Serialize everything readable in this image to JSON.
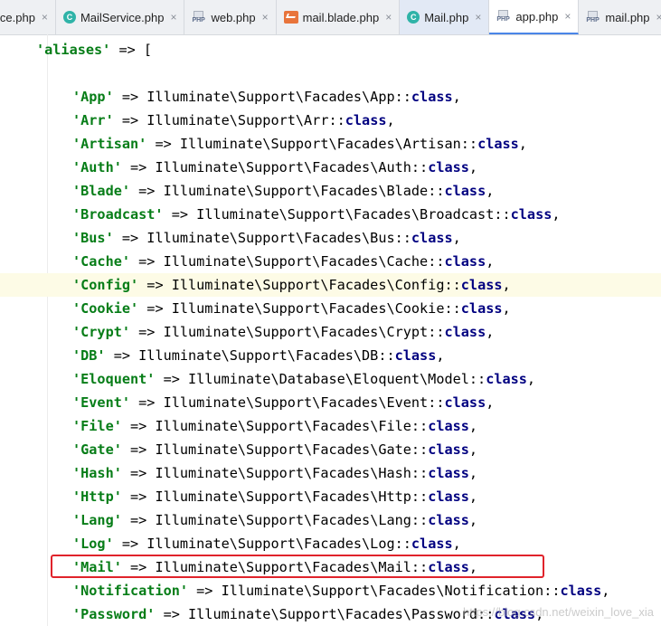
{
  "tabs": [
    {
      "label": "ice.php",
      "icon": "php-file-icon",
      "active": false
    },
    {
      "label": "MailService.php",
      "icon": "php-class-icon",
      "active": false
    },
    {
      "label": "web.php",
      "icon": "php-file-icon",
      "active": false
    },
    {
      "label": "mail.blade.php",
      "icon": "blade-file-icon",
      "active": false
    },
    {
      "label": "Mail.php",
      "icon": "php-class-icon",
      "active": false,
      "highlight": true
    },
    {
      "label": "app.php",
      "icon": "php-file-icon",
      "active": true
    },
    {
      "label": "mail.php",
      "icon": "php-file-icon",
      "active": false
    }
  ],
  "code": {
    "opening": {
      "key": "'aliases'",
      "arrow": " => ",
      "bracket": "["
    },
    "aliases": [
      {
        "key": "'App'",
        "value": "Illuminate\\Support\\Facades\\App"
      },
      {
        "key": "'Arr'",
        "value": "Illuminate\\Support\\Arr"
      },
      {
        "key": "'Artisan'",
        "value": "Illuminate\\Support\\Facades\\Artisan"
      },
      {
        "key": "'Auth'",
        "value": "Illuminate\\Support\\Facades\\Auth"
      },
      {
        "key": "'Blade'",
        "value": "Illuminate\\Support\\Facades\\Blade"
      },
      {
        "key": "'Broadcast'",
        "value": "Illuminate\\Support\\Facades\\Broadcast"
      },
      {
        "key": "'Bus'",
        "value": "Illuminate\\Support\\Facades\\Bus"
      },
      {
        "key": "'Cache'",
        "value": "Illuminate\\Support\\Facades\\Cache"
      },
      {
        "key": "'Config'",
        "value": "Illuminate\\Support\\Facades\\Config",
        "highlighted": true
      },
      {
        "key": "'Cookie'",
        "value": "Illuminate\\Support\\Facades\\Cookie"
      },
      {
        "key": "'Crypt'",
        "value": "Illuminate\\Support\\Facades\\Crypt"
      },
      {
        "key": "'DB'",
        "value": "Illuminate\\Support\\Facades\\DB"
      },
      {
        "key": "'Eloquent'",
        "value": "Illuminate\\Database\\Eloquent\\Model"
      },
      {
        "key": "'Event'",
        "value": "Illuminate\\Support\\Facades\\Event"
      },
      {
        "key": "'File'",
        "value": "Illuminate\\Support\\Facades\\File"
      },
      {
        "key": "'Gate'",
        "value": "Illuminate\\Support\\Facades\\Gate"
      },
      {
        "key": "'Hash'",
        "value": "Illuminate\\Support\\Facades\\Hash"
      },
      {
        "key": "'Http'",
        "value": "Illuminate\\Support\\Facades\\Http"
      },
      {
        "key": "'Lang'",
        "value": "Illuminate\\Support\\Facades\\Lang"
      },
      {
        "key": "'Log'",
        "value": "Illuminate\\Support\\Facades\\Log"
      },
      {
        "key": "'Mail'",
        "value": "Illuminate\\Support\\Facades\\Mail",
        "boxed": true
      },
      {
        "key": "'Notification'",
        "value": "Illuminate\\Support\\Facades\\Notification"
      },
      {
        "key": "'Password'",
        "value": "Illuminate\\Support\\Facades\\Password"
      }
    ],
    "arrow": " => ",
    "suffix_sep": "::",
    "suffix_kw": "class",
    "suffix_end": ","
  },
  "annotation": {
    "color": "#e0232b"
  },
  "watermark": "https://blog.csdn.net/weixin_love_xia"
}
